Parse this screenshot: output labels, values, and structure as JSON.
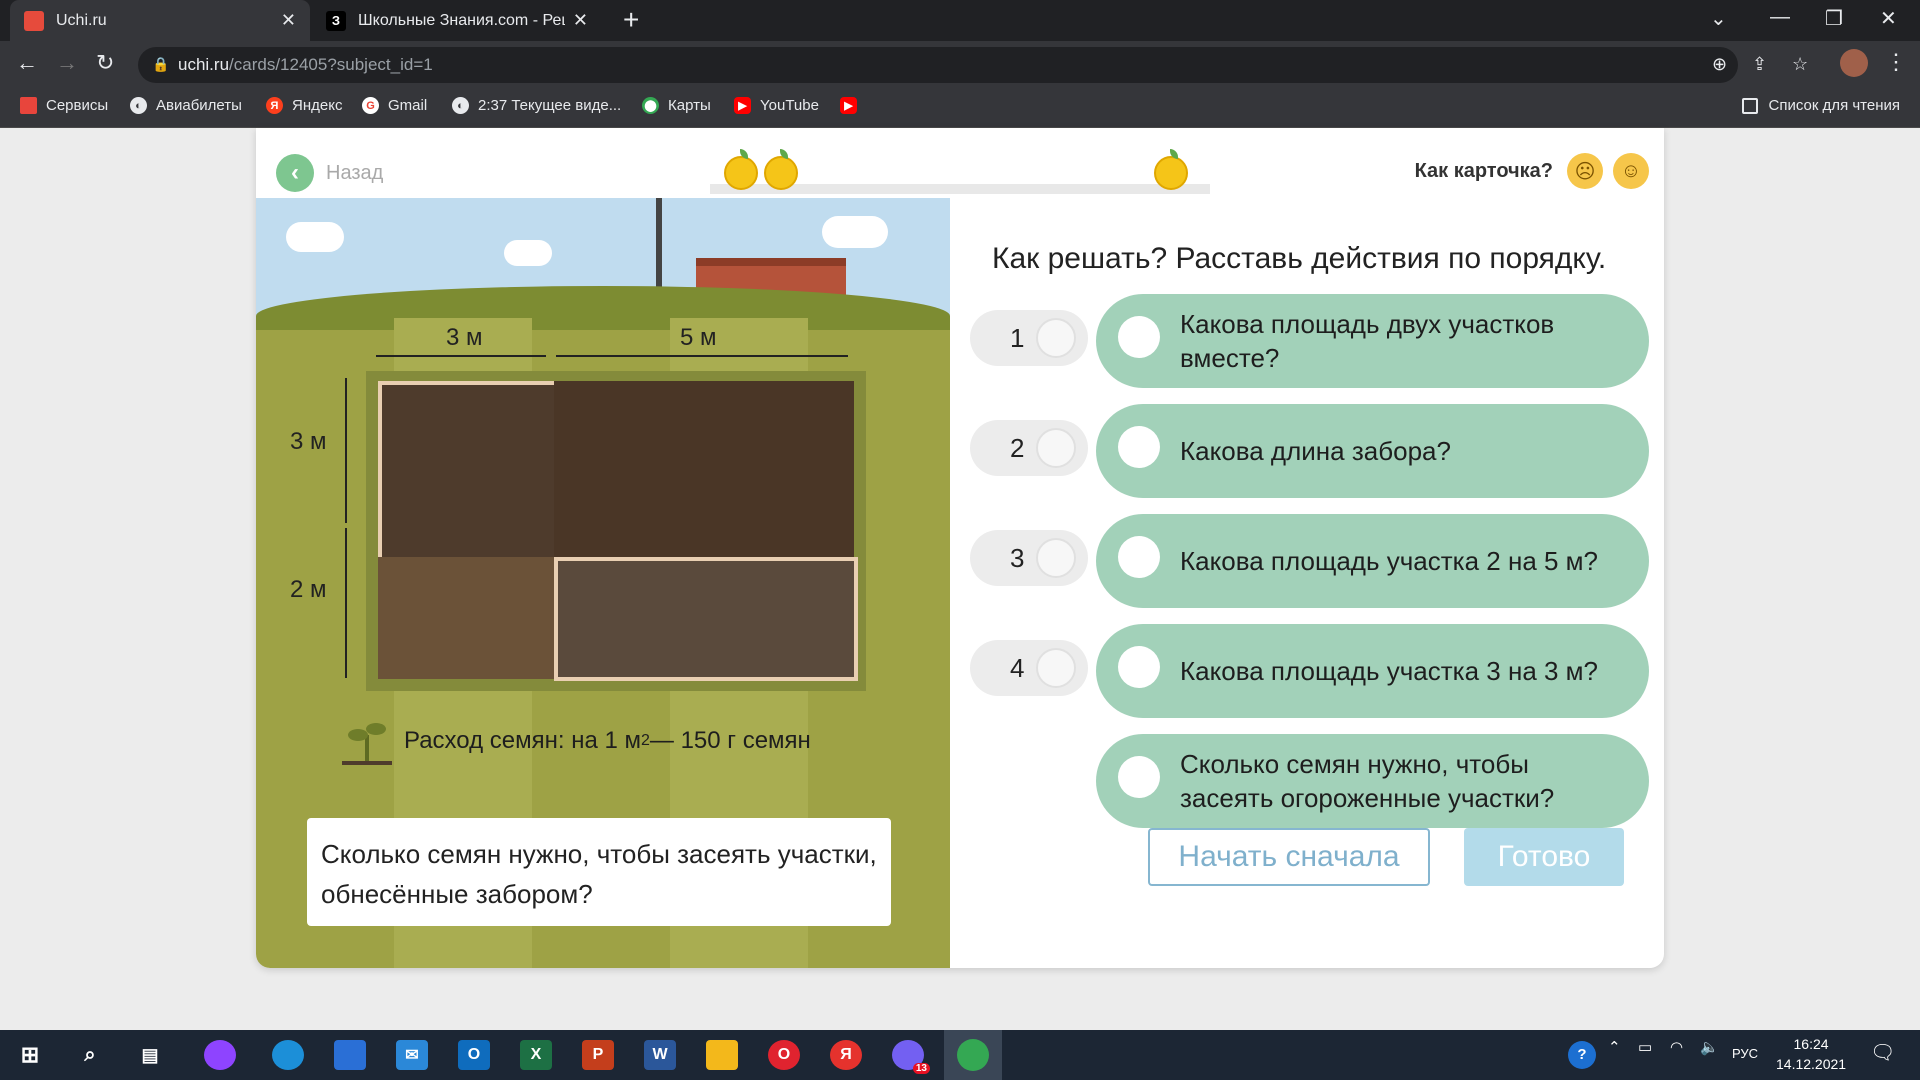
{
  "browser": {
    "tabs": [
      {
        "title": "Uchi.ru",
        "fav_color": "#e64b3c",
        "fav_text": ""
      },
      {
        "title": "Школьные Знания.com - Решае",
        "fav_color": "#000000",
        "fav_text": "З"
      }
    ],
    "url_host": "uchi.ru",
    "url_path": "/cards/12405?subject_id=1",
    "bookmarks": [
      {
        "label": "Сервисы",
        "icon": "apps-grid-icon",
        "color": "#e8453c"
      },
      {
        "label": "Авиабилеты",
        "icon": "globe-icon",
        "color": "#ffffff"
      },
      {
        "label": "Яндекс",
        "icon": "yandex-icon",
        "color": "#fc3f1d"
      },
      {
        "label": "Gmail",
        "icon": "google-icon",
        "color": "#ea4335"
      },
      {
        "label": "2:37 Текущее виде...",
        "icon": "globe-icon",
        "color": "#ffffff"
      },
      {
        "label": "Карты",
        "icon": "maps-pin-icon",
        "color": "#34a853"
      },
      {
        "label": "YouTube",
        "icon": "youtube-icon",
        "color": "#ff0000"
      },
      {
        "label": "",
        "icon": "youtube-icon",
        "color": "#ff0000"
      }
    ],
    "reading_list": "Список для чтения"
  },
  "card": {
    "back_label": "Назад",
    "rate_label": "Как карточка?",
    "scene": {
      "dim_top_1": "3 м",
      "dim_top_2": "5 м",
      "dim_left_1": "3 м",
      "dim_left_2": "2 м",
      "seed_text": "Расход семян: на 1 м",
      "seed_sup": "2",
      "seed_text_2": " — 150 г семян",
      "question": "Сколько семян нужно, чтобы засеять участки, обнесённые забором?"
    },
    "heading": "Как решать? Расставь действия по порядку.",
    "slots": [
      "1",
      "2",
      "3",
      "4"
    ],
    "answers": [
      "Какова площадь двух участков вместе?",
      "Какова длина забора?",
      "Какова площадь участка 2 на 5 м?",
      "Какова площадь участка 3 на 3 м?",
      "Сколько семян нужно, чтобы засеять огороженные участки?"
    ],
    "restart_label": "Начать сначала",
    "done_label": "Готово"
  },
  "taskbar": {
    "lang": "РУС",
    "time": "16:24",
    "date": "14.12.2021",
    "notif_count": "13",
    "apps": [
      {
        "icon": "alice-icon",
        "color": "#8e44ff",
        "text": ""
      },
      {
        "icon": "edge-icon",
        "color": "#1c8fd8",
        "text": ""
      },
      {
        "icon": "store-icon",
        "color": "#2a6fd6",
        "text": ""
      },
      {
        "icon": "mail-icon",
        "color": "#2b88d8",
        "text": ""
      },
      {
        "icon": "outlook-icon",
        "color": "#0f6cbd",
        "text": "O"
      },
      {
        "icon": "excel-icon",
        "color": "#1d7044",
        "text": "X"
      },
      {
        "icon": "powerpoint-icon",
        "color": "#c43e1c",
        "text": "P"
      },
      {
        "icon": "word-icon",
        "color": "#2b579a",
        "text": "W"
      },
      {
        "icon": "explorer-icon",
        "color": "#f3b81b",
        "text": ""
      },
      {
        "icon": "opera-icon",
        "color": "#e0232f",
        "text": "O"
      },
      {
        "icon": "yandex-browser-icon",
        "color": "#e5322d",
        "text": "Я"
      },
      {
        "icon": "viber-icon",
        "color": "#7360f2",
        "text": ""
      },
      {
        "icon": "chrome-icon",
        "color": "#34a853",
        "text": ""
      }
    ]
  }
}
